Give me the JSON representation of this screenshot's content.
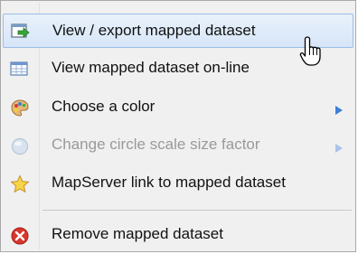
{
  "menu": {
    "items": [
      {
        "label": "View / export mapped dataset",
        "icon": "export-arrow-icon",
        "state": "hover"
      },
      {
        "label": "View mapped dataset on-line",
        "icon": "table-icon",
        "state": "normal"
      },
      {
        "label": "Choose a color",
        "icon": "palette-icon",
        "state": "normal",
        "submenu": true
      },
      {
        "label": "Change circle scale size factor",
        "icon": "circle-icon",
        "state": "disabled",
        "submenu": true
      },
      {
        "label": "MapServer link to mapped dataset",
        "icon": "star-icon",
        "state": "normal"
      },
      {
        "label": "Remove mapped dataset",
        "icon": "remove-icon",
        "state": "normal"
      }
    ]
  },
  "colors": {
    "hover_bg": "#d6e6f8",
    "hover_border": "#9dbde8",
    "submenu_arrow": "#3d7fd6",
    "disabled_text": "#9a9a9a"
  }
}
